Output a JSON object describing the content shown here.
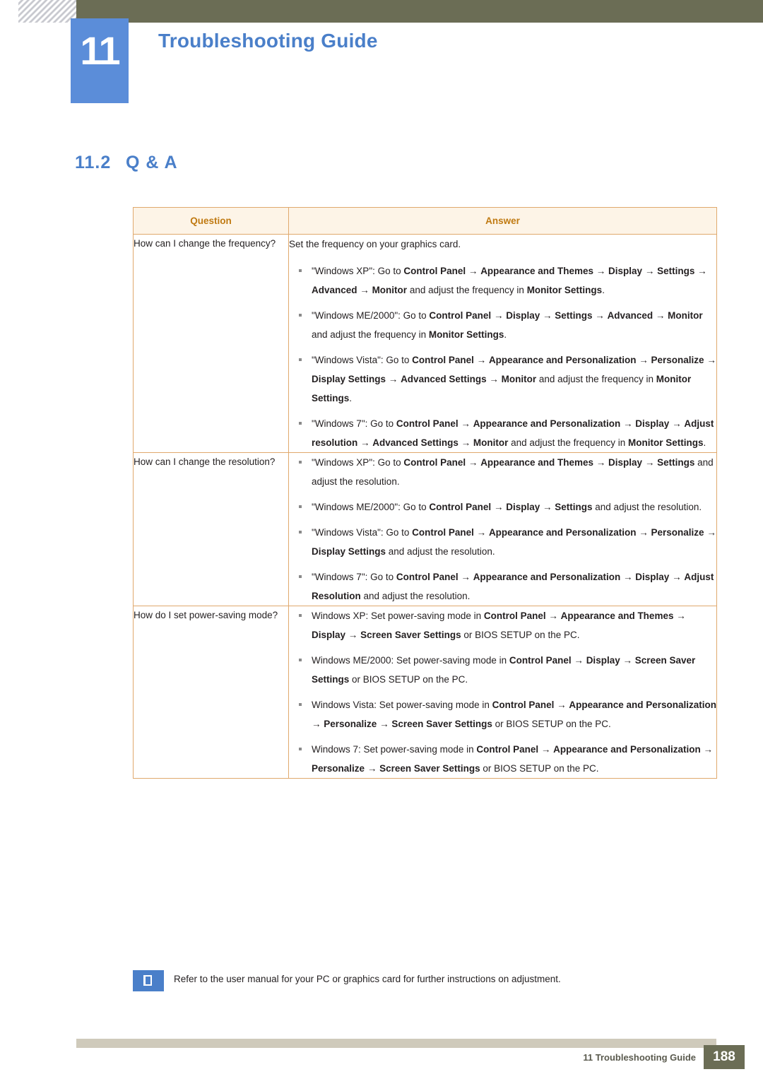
{
  "header": {
    "chapter_number": "11",
    "chapter_title": "Troubleshooting Guide"
  },
  "section": {
    "number": "11.2",
    "title": "Q & A"
  },
  "table": {
    "headers": {
      "question": "Question",
      "answer": "Answer"
    },
    "rows": [
      {
        "question": "How can I change the frequency?",
        "intro": "Set the frequency on your graphics card.",
        "items": [
          "\"Windows XP\": Go to <b>Control Panel</b> <b>→</b> <b>Appearance and Themes</b> <b>→</b> <b>Display</b> <b>→</b> <b>Settings</b> <b>→</b> <b>Advanced</b> <b>→</b> <b>Monitor</b> and adjust the frequency in <b>Monitor Settings</b>.",
          "\"Windows ME/2000\": Go to <b>Control Panel</b> <b>→</b> <b>Display</b> <b>→</b> <b>Settings</b> <b>→</b> <b>Advanced</b> <b>→</b> <b>Monitor</b> and adjust the frequency in <b>Monitor Settings</b>.",
          "\"Windows Vista\": Go to <b>Control Panel</b> <b>→</b> <b>Appearance and Personalization</b> <b>→</b> <b>Personalize</b> <b>→</b> <b>Display Settings</b> <b>→</b> <b>Advanced Settings</b> <b>→</b> <b>Monitor</b> and adjust the frequency in <b>Monitor Settings</b>.",
          "\"Windows 7\": Go to <b>Control Panel</b> <b>→</b> <b>Appearance and Personalization</b> <b>→</b> <b>Display</b> <b>→</b> <b>Adjust resolution</b> <b>→</b> <b>Advanced Settings</b> <b>→</b> <b>Monitor</b> and adjust the frequency in <b>Monitor Settings</b>."
        ]
      },
      {
        "question": "How can I change the resolution?",
        "intro": "",
        "items": [
          "\"Windows XP\": Go to <b>Control Panel</b> <b>→</b> <b>Appearance and Themes</b> <b>→</b> <b>Display</b> <b>→</b> <b>Settings</b> and adjust the resolution.",
          "\"Windows ME/2000\": Go to <b>Control Panel</b> <b>→</b> <b>Display</b> <b>→</b> <b>Settings</b> and adjust the resolution.",
          "\"Windows Vista\": Go to <b>Control Panel</b> <b>→</b> <b>Appearance and Personalization</b> <b>→</b> <b>Personalize</b> <b>→</b> <b>Display Settings</b> and adjust the resolution.",
          "\"Windows 7\": Go to <b>Control Panel</b> <b>→</b> <b>Appearance and Personalization</b> <b>→</b> <b>Display</b> <b>→</b> <b>Adjust Resolution</b> and adjust the resolution."
        ]
      },
      {
        "question": "How do I set power-saving mode?",
        "intro": "",
        "items": [
          "Windows XP: Set power-saving mode in <b>Control Panel</b> <b>→</b> <b>Appearance and Themes</b> <b>→</b> <b>Display</b> <b>→</b> <b>Screen Saver Settings</b> or BIOS SETUP on the PC.",
          "Windows ME/2000: Set power-saving mode in <b>Control Panel</b> <b>→</b> <b>Display</b> <b>→</b> <b>Screen Saver Settings</b> or BIOS SETUP on the PC.",
          "Windows Vista: Set power-saving mode in <b>Control Panel</b> <b>→</b> <b>Appearance and Personalization</b> <b>→</b> <b>Personalize</b> <b>→</b> <b>Screen Saver Settings</b> or BIOS SETUP on the PC.",
          "Windows 7: Set power-saving mode in <b>Control Panel</b> <b>→</b> <b>Appearance and Personalization</b> <b>→</b> <b>Personalize</b> <b>→</b> <b>Screen Saver Settings</b> or BIOS SETUP on the PC."
        ]
      }
    ]
  },
  "note": {
    "icon": "note-book-icon",
    "text": "Refer to the user manual for your PC or graphics card for further instructions on adjustment."
  },
  "footer": {
    "text": "11 Troubleshooting Guide",
    "page_number": "188"
  }
}
